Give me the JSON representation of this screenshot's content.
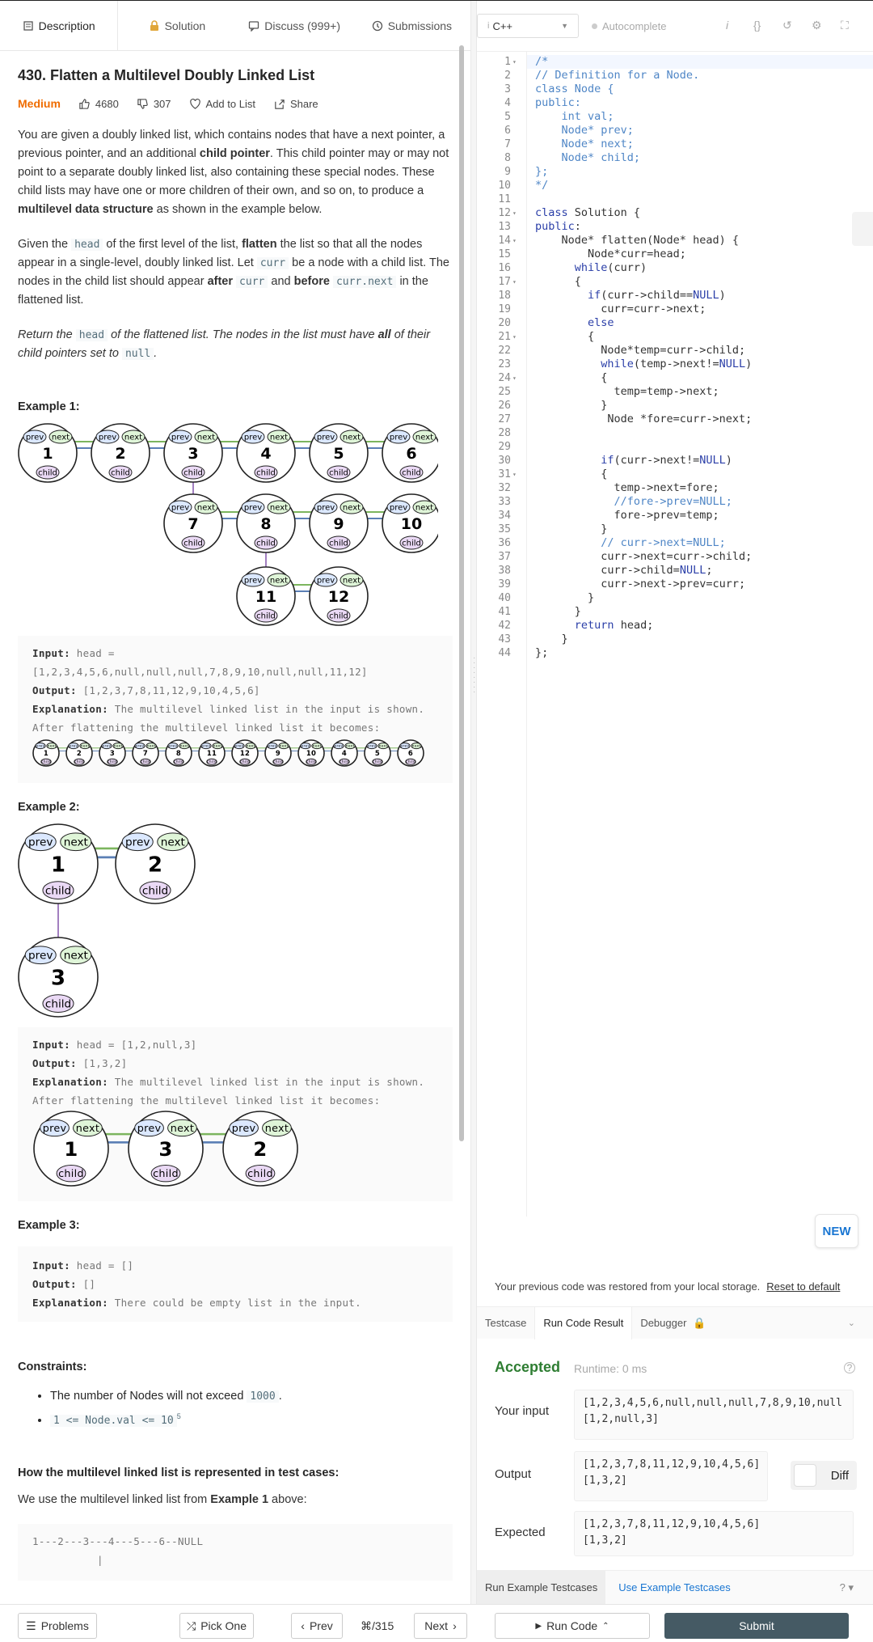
{
  "tabs": {
    "description": "Description",
    "solution": "Solution",
    "discuss": "Discuss (999+)",
    "submissions": "Submissions"
  },
  "problem": {
    "title": "430. Flatten a Multilevel Doubly Linked List",
    "difficulty": "Medium",
    "likes": "4680",
    "dislikes": "307",
    "add_to_list": "Add to List",
    "share": "Share",
    "p1": [
      "You are given a doubly linked list, which contains nodes that have a next pointer, a previous pointer, and an additional ",
      "child pointer",
      ". This child pointer may or may not point to a separate doubly linked list, also containing these special nodes. These child lists may have one or more children of their own, and so on, to produce a ",
      "multilevel data structure",
      " as shown in the example below."
    ],
    "p2": [
      "Given the ",
      "head",
      " of the first level of the list, ",
      "flatten",
      " the list so that all the nodes appear in a single-level, doubly linked list. Let ",
      "curr",
      " be a node with a child list. The nodes in the child list should appear ",
      "after",
      " ",
      "curr",
      " and ",
      "before",
      " ",
      "curr.next",
      " in the flattened list."
    ],
    "p3": [
      "Return the ",
      "head",
      " of the flattened list. The nodes in the list must have ",
      "all",
      " of their child pointers set to ",
      "null",
      "."
    ],
    "examples": [
      {
        "heading": "Example 1:",
        "input": "head = [1,2,3,4,5,6,null,null,null,7,8,9,10,null,null,11,12]",
        "output": "[1,2,3,7,8,11,12,9,10,4,5,6]",
        "explanation": "The multilevel linked list in the input is shown.",
        "after": "After flattening the multilevel linked list it becomes:"
      },
      {
        "heading": "Example 2:",
        "input": "head = [1,2,null,3]",
        "output": "[1,3,2]",
        "explanation": "The multilevel linked list in the input is shown.",
        "after": "After flattening the multilevel linked list it becomes:"
      },
      {
        "heading": "Example 3:",
        "input": "head = []",
        "output": "[]",
        "explanation": "There could be empty list in the input."
      }
    ],
    "labels": {
      "input": "Input:",
      "output": "Output:",
      "explanation": "Explanation:"
    },
    "constraints_heading": "Constraints:",
    "constraints": [
      [
        "The number of Nodes will not exceed ",
        "1000",
        "."
      ],
      [
        "1 <= Node.val <= 10",
        "5"
      ]
    ],
    "repr_heading": "How the multilevel linked list is represented in test cases:",
    "repr_text": [
      "We use the multilevel linked list from ",
      "Example 1",
      " above:"
    ],
    "repr_code": "1---2---3---4---5---6--NULL",
    "node_labels": {
      "prev": "prev",
      "next": "next",
      "child": "child"
    },
    "ex1_rows": [
      [
        "1",
        "2",
        "3",
        "4",
        "5",
        "6"
      ],
      [
        "7",
        "8",
        "9",
        "10"
      ],
      [
        "11",
        "12"
      ]
    ],
    "ex1_flat": [
      "1",
      "2",
      "3",
      "7",
      "8",
      "11",
      "12",
      "9",
      "10",
      "4",
      "5",
      "6"
    ],
    "ex2_rows": [
      [
        "1",
        "2"
      ],
      [
        "3"
      ]
    ],
    "ex2_flat": [
      "1",
      "3",
      "2"
    ]
  },
  "editor": {
    "language": "C++",
    "autocomplete": "Autocomplete",
    "lines": [
      "/*",
      "// Definition for a Node.",
      "class Node {",
      "public:",
      "    int val;",
      "    Node* prev;",
      "    Node* next;",
      "    Node* child;",
      "};",
      "*/",
      "",
      "class Solution {",
      "public:",
      "    Node* flatten(Node* head) {",
      "        Node*curr=head;",
      "      while(curr)",
      "      {",
      "        if(curr->child==NULL)",
      "          curr=curr->next;",
      "        else",
      "        {",
      "          Node*temp=curr->child;",
      "          while(temp->next!=NULL)",
      "          {",
      "            temp=temp->next;",
      "          }",
      "           Node *fore=curr->next;",
      "",
      "",
      "          if(curr->next!=NULL)",
      "          {",
      "            temp->next=fore;",
      "            //fore->prev=NULL;",
      "            fore->prev=temp;",
      "          }",
      "          // curr->next=NULL;",
      "          curr->next=curr->child;",
      "          curr->child=NULL;",
      "          curr->next->prev=curr;",
      "        }",
      "      }",
      "      return head;",
      "    }",
      "};"
    ],
    "fold_lines": [
      1,
      12,
      14,
      17,
      21,
      24,
      31
    ],
    "new_badge": "NEW"
  },
  "console": {
    "restore_msg": "Your previous code was restored from your local storage.",
    "reset_link": "Reset to default",
    "tabs": [
      "Testcase",
      "Run Code Result",
      "Debugger"
    ],
    "status": "Accepted",
    "runtime": "Runtime: 0 ms",
    "your_input_label": "Your input",
    "your_input": "[1,2,3,4,5,6,null,null,null,7,8,9,10,null\n[1,2,null,3]",
    "output_label": "Output",
    "output": "[1,2,3,7,8,11,12,9,10,4,5,6]\n[1,3,2]",
    "expected_label": "Expected",
    "expected": "[1,2,3,7,8,11,12,9,10,4,5,6]\n[1,3,2]",
    "diff": "Diff",
    "run_example": "Run Example Testcases",
    "use_example": "Use Example Testcases"
  },
  "bottom": {
    "problems": "Problems",
    "pick_one": "Pick One",
    "prev": "Prev",
    "page": "/315",
    "next": "Next",
    "run_code": "Run Code",
    "submit": "Submit"
  },
  "colors": {
    "accent": "#1976d2",
    "medium": "#ef6c00",
    "accepted": "#2e7d32",
    "submit": "#455a64"
  }
}
